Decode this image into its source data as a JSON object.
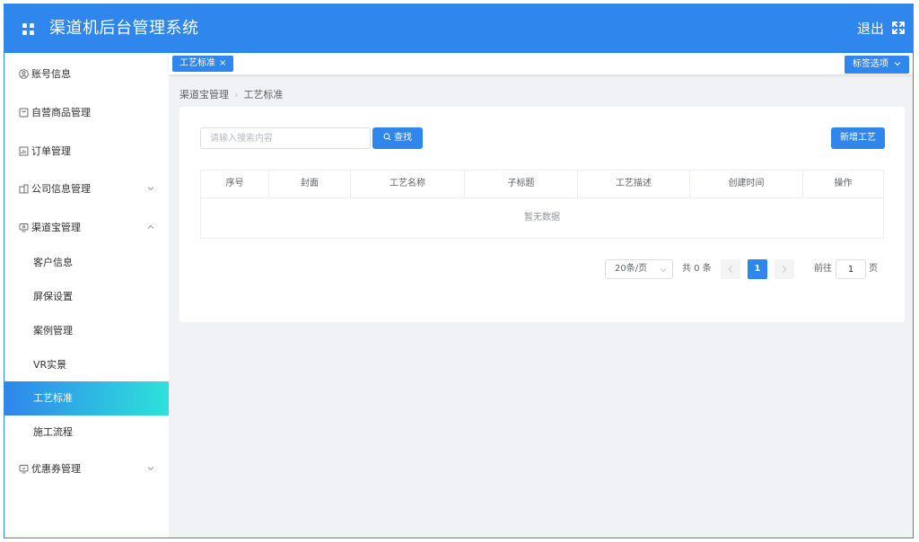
{
  "header": {
    "title": "渠道机后台管理系统",
    "logout_label": "退出",
    "background_color": "#2f86ec"
  },
  "sidebar": {
    "items": [
      {
        "label": "账号信息",
        "icon": "user-circle-icon"
      },
      {
        "label": "自营商品管理",
        "icon": "shopping-bag-icon"
      },
      {
        "label": "订单管理",
        "icon": "order-chart-icon"
      },
      {
        "label": "公司信息管理",
        "icon": "building-icon",
        "arrow": "down"
      },
      {
        "label": "渠道宝管理",
        "icon": "monitor-icon",
        "arrow": "up"
      },
      {
        "label": "优惠券管理",
        "icon": "coupon-monitor-icon",
        "arrow": "down"
      }
    ],
    "sub_items": [
      {
        "label": "客户信息"
      },
      {
        "label": "屏保设置"
      },
      {
        "label": "案例管理"
      },
      {
        "label": "VR实景"
      },
      {
        "label": "工艺标准",
        "active": true
      },
      {
        "label": "施工流程"
      }
    ],
    "active_gradient": [
      "#2f86ec",
      "#2ee2da"
    ]
  },
  "tags": {
    "active_tag": "工艺标准",
    "close_symbol": "×",
    "options_label": "标签选项"
  },
  "breadcrumb": {
    "parent": "渠道宝管理",
    "separator": "›",
    "current": "工艺标准"
  },
  "toolbar": {
    "search_placeholder": "请输入搜索内容",
    "search_value": "",
    "search_label": "查找",
    "add_label": "新增工艺"
  },
  "table": {
    "columns": [
      "序号",
      "封面",
      "工艺名称",
      "子标题",
      "工艺描述",
      "创建时间",
      "操作"
    ],
    "rows": [],
    "empty_text": "暂无数据"
  },
  "pagination": {
    "page_size": "20条/页",
    "total": "共 0 条",
    "current_page": "1",
    "goto_label": "前往",
    "goto_value": "1",
    "page_unit": "页"
  }
}
